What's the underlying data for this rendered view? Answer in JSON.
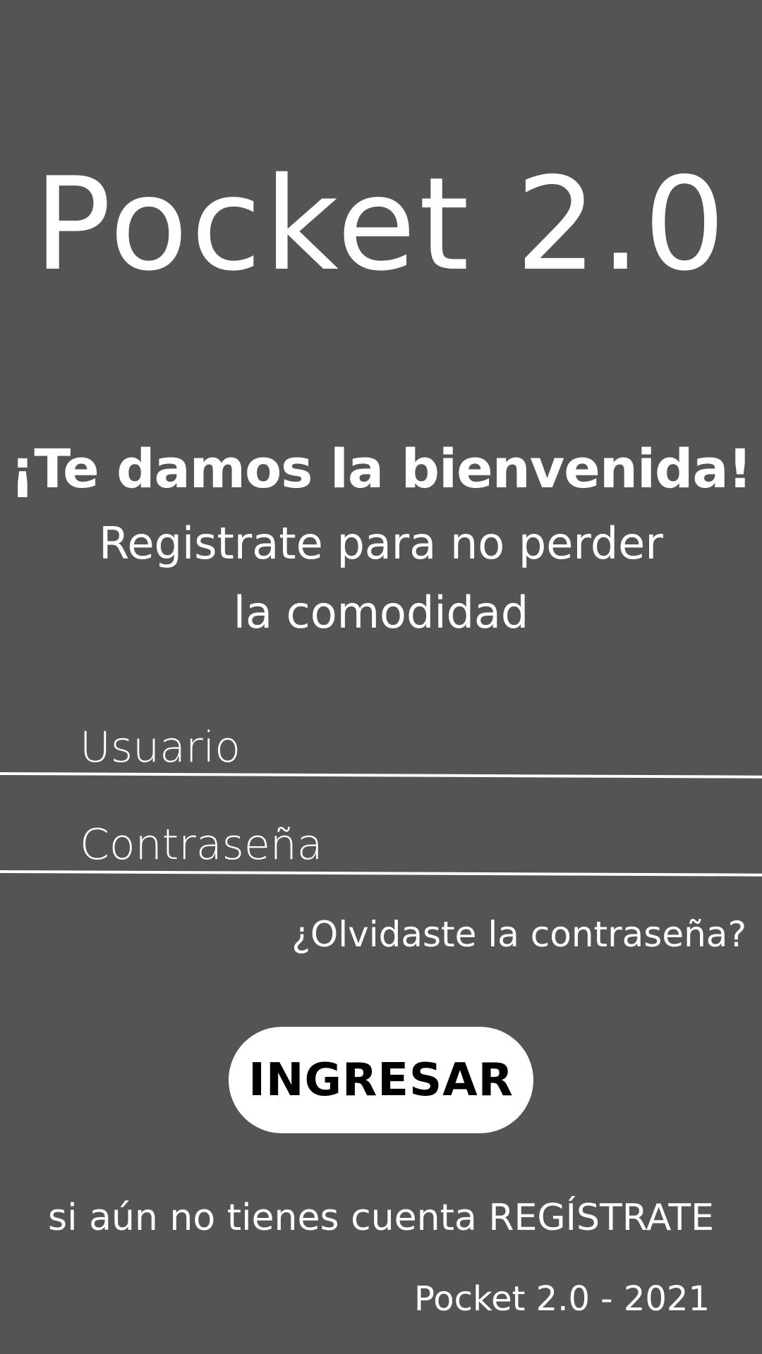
{
  "app": {
    "title": "Pocket 2.0",
    "welcome": "¡Te damos la bienvenida!",
    "subtitle_line1": "Registrate para no perder",
    "subtitle_line2": "la comodidad"
  },
  "form": {
    "username_placeholder": "Usuario",
    "username_value": "",
    "password_placeholder": "Contraseña",
    "password_value": "",
    "forgot_label": "¿Olvidaste la contraseña?",
    "submit_label": "INGRESAR"
  },
  "register": {
    "prompt": "si aún no tienes cuenta ",
    "link_label": "REGÍSTRATE"
  },
  "footer": {
    "text": "Pocket 2.0 - 2021"
  },
  "colors": {
    "background": "#545454",
    "foreground": "#ffffff",
    "button_text": "#000000"
  }
}
